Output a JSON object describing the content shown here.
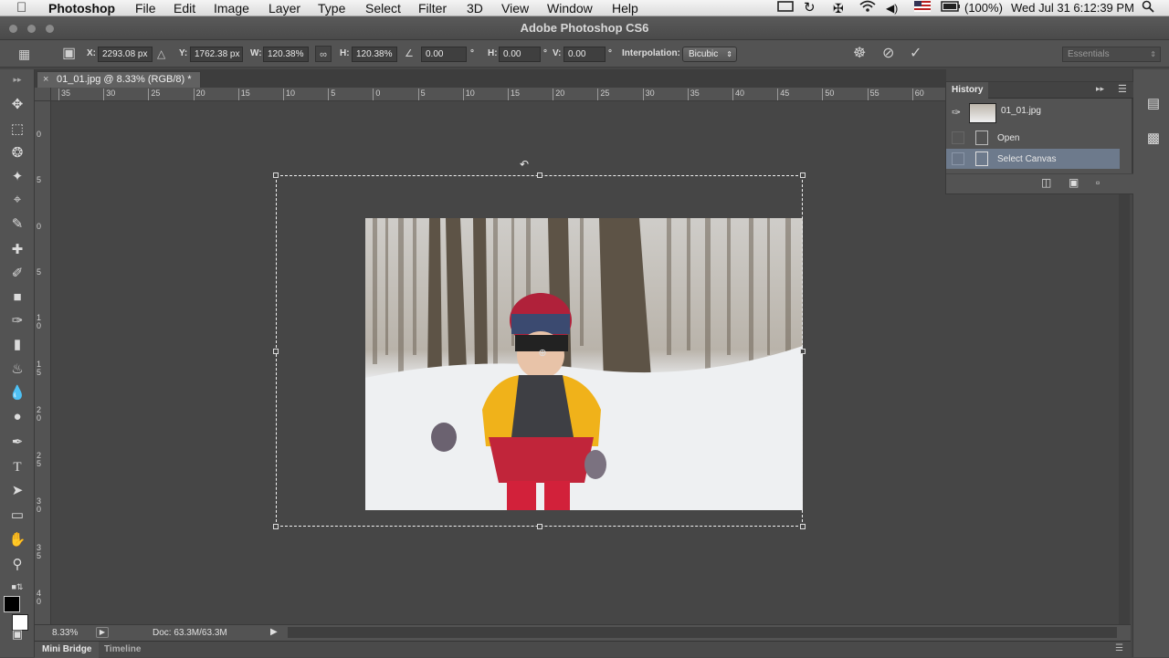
{
  "menubar": {
    "app": "Photoshop",
    "items": [
      "File",
      "Edit",
      "Image",
      "Layer",
      "Type",
      "Select",
      "Filter",
      "3D",
      "View",
      "Window",
      "Help"
    ],
    "battery": "(100%)",
    "clock": "Wed Jul 31  6:12:39 PM"
  },
  "window": {
    "title": "Adobe Photoshop CS6"
  },
  "options": {
    "x_label": "X:",
    "x_value": "2293.08 px",
    "y_label": "Y:",
    "y_value": "1762.38 px",
    "w_label": "W:",
    "w_value": "120.38%",
    "h_label": "H:",
    "h_value": "120.38%",
    "angle_value": "0.00",
    "deg": "°",
    "hskew_label": "H:",
    "hskew_value": "0.00",
    "vskew_label": "V:",
    "vskew_value": "0.00",
    "interp_label": "Interpolation:",
    "interp_value": "Bicubic",
    "workspace": "Essentials"
  },
  "document": {
    "tab_label": "01_01.jpg @ 8.33% (RGB/8) *",
    "zoom": "8.33%",
    "doc_size": "Doc: 63.3M/63.3M"
  },
  "ruler_top": [
    "35",
    "30",
    "25",
    "20",
    "15",
    "10",
    "5",
    "0",
    "5",
    "10",
    "15",
    "20",
    "25",
    "30",
    "35",
    "40",
    "45",
    "50",
    "55",
    "60"
  ],
  "ruler_left": [
    "0",
    "5",
    "0",
    "5",
    "1 0",
    "1 5",
    "2 0",
    "2 5",
    "3 0",
    "3 5",
    "4 0"
  ],
  "history": {
    "tab": "History",
    "snapshot": "01_01.jpg",
    "items": [
      "Open",
      "Select Canvas"
    ]
  },
  "bottom_tabs": [
    "Mini Bridge",
    "Timeline"
  ]
}
